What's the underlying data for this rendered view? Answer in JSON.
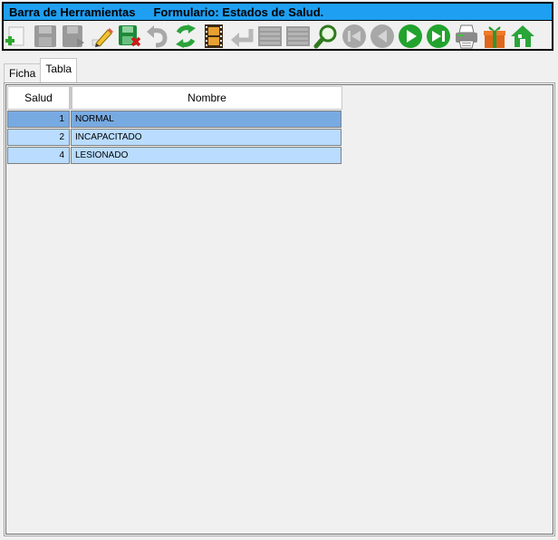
{
  "toolbar": {
    "title_left": "Barra de Herramientas",
    "title_right": "Formulario: Estados de Salud.",
    "buttons": [
      {
        "icon": "add-icon"
      },
      {
        "icon": "save-disabled-icon"
      },
      {
        "icon": "save-as-disabled-icon"
      },
      {
        "icon": "edit-pencil-icon"
      },
      {
        "icon": "save-delete-icon"
      },
      {
        "icon": "undo-disabled-icon"
      },
      {
        "icon": "refresh-icon"
      },
      {
        "icon": "film-icon"
      },
      {
        "icon": "back-arrow-disabled-icon"
      },
      {
        "icon": "grid-disabled-icon"
      },
      {
        "icon": "grid-disabled-icon"
      },
      {
        "icon": "search-icon"
      },
      {
        "icon": "first-record-disabled-icon"
      },
      {
        "icon": "previous-record-disabled-icon"
      },
      {
        "icon": "next-record-icon"
      },
      {
        "icon": "last-record-icon"
      },
      {
        "icon": "printer-icon"
      },
      {
        "icon": "gift-icon"
      },
      {
        "icon": "home-icon"
      }
    ]
  },
  "tabs": [
    {
      "label": "Ficha",
      "active": false
    },
    {
      "label": "Tabla",
      "active": true
    }
  ],
  "table": {
    "columns": [
      "Salud",
      "Nombre"
    ],
    "rows": [
      {
        "id": "1",
        "name": "NORMAL",
        "selected": true
      },
      {
        "id": "2",
        "name": "INCAPACITADO",
        "selected": false
      },
      {
        "id": "4",
        "name": "LESIONADO",
        "selected": false
      }
    ]
  },
  "colors": {
    "title_bar": "#1e9ff2",
    "row_selected": "#78aae2",
    "row_normal": "#b9dcff"
  }
}
